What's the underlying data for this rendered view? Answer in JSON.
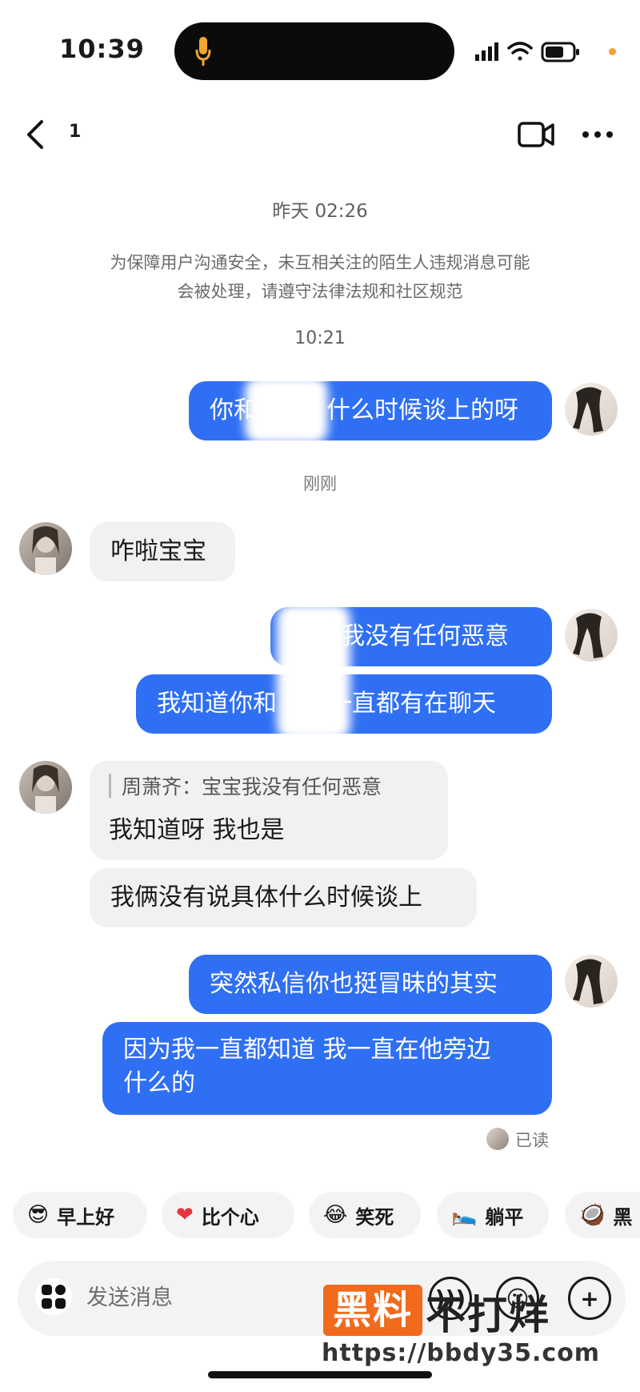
{
  "status_bar": {
    "time": "10:39"
  },
  "header": {
    "back_count": "1"
  },
  "messages": {
    "time_1": "昨天 02:26",
    "notice_line1": "为保障用户沟通安全，未互相关注的陌生人违规消息可能",
    "notice_line2": "会被处理，请遵守法律法规和社区规范",
    "time_2": "10:21",
    "out_1_left": "你和",
    "out_1_right": "什么时候谈上的呀",
    "time_3": "刚刚",
    "in_1": "咋啦宝宝",
    "out_2": "宝宝我没有任何恶意",
    "out_3_left": "我知道你和",
    "out_3_right": "一直都有在聊天",
    "quote_sender": "周萧齐：",
    "quote_text": "宝宝我没有任何恶意",
    "in_2": "我知道呀 我也是",
    "in_3": "我俩没有说具体什么时候谈上",
    "out_4": "突然私信你也挺冒昧的其实",
    "out_5_line1": "因为我一直都知道 我一直在他旁边",
    "out_5_line2": "什么的",
    "read_status": "已读"
  },
  "quick_replies": [
    {
      "icon": "sunglasses-emoji-icon",
      "emoji": "😎",
      "label": "早上好"
    },
    {
      "icon": "heart-emoji-icon",
      "emoji": "❤",
      "label": "比个心"
    },
    {
      "icon": "laugh-emoji-icon",
      "emoji": "😂",
      "label": "笑死"
    },
    {
      "icon": "lie-flat-emoji-icon",
      "emoji": "🛌",
      "label": "躺平"
    },
    {
      "icon": "emoji-icon",
      "emoji": "🥥",
      "label": "黑"
    }
  ],
  "input": {
    "placeholder": "发送消息"
  },
  "watermark": {
    "badge": "黑料",
    "text": "不打烊",
    "url": "https://bbdy35.com"
  },
  "colors": {
    "outgoing_bubble": "#2f6ff3",
    "incoming_bubble": "#f1f1f1",
    "watermark_orange": "#f26a1b"
  }
}
